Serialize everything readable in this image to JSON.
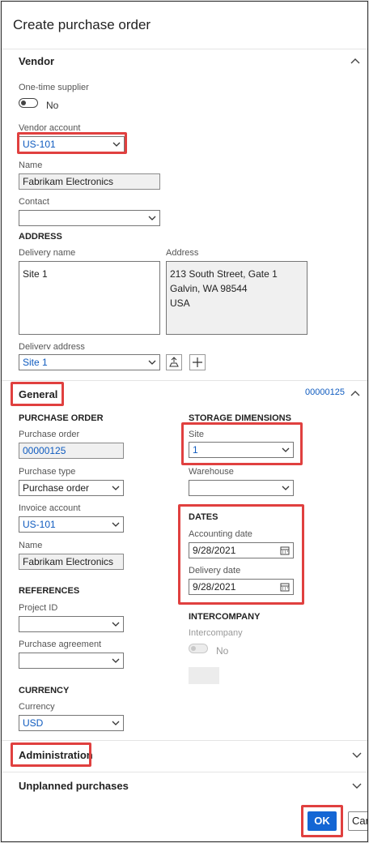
{
  "dialog": {
    "title": "Create purchase order"
  },
  "vendor": {
    "section_label": "Vendor",
    "one_time_supplier_label": "One-time supplier",
    "one_time_supplier_value": "No",
    "vendor_account_label": "Vendor account",
    "vendor_account_value": "US-101",
    "name_label": "Name",
    "name_value": "Fabrikam Electronics",
    "contact_label": "Contact",
    "contact_value": "",
    "address_heading": "ADDRESS",
    "delivery_name_label": "Delivery name",
    "delivery_name_value": "Site 1",
    "address_label": "Address",
    "address_lines": [
      "213 South Street, Gate 1",
      "Galvin, WA 98544",
      "USA"
    ],
    "delivery_address_label": "Delivery address",
    "delivery_address_value": "Site 1"
  },
  "general": {
    "section_label": "General",
    "summary_value": "00000125",
    "purchase_order_heading": "PURCHASE ORDER",
    "purchase_order_label": "Purchase order",
    "purchase_order_value": "00000125",
    "purchase_type_label": "Purchase type",
    "purchase_type_value": "Purchase order",
    "invoice_account_label": "Invoice account",
    "invoice_account_value": "US-101",
    "name_label": "Name",
    "name_value": "Fabrikam Electronics",
    "references_heading": "REFERENCES",
    "project_id_label": "Project ID",
    "project_id_value": "",
    "purchase_agreement_label": "Purchase agreement",
    "purchase_agreement_value": "",
    "currency_heading": "CURRENCY",
    "currency_label": "Currency",
    "currency_value": "USD",
    "storage_heading": "STORAGE DIMENSIONS",
    "site_label": "Site",
    "site_value": "1",
    "warehouse_label": "Warehouse",
    "warehouse_value": "",
    "dates_heading": "DATES",
    "accounting_date_label": "Accounting date",
    "accounting_date_value": "9/28/2021",
    "delivery_date_label": "Delivery date",
    "delivery_date_value": "9/28/2021",
    "intercompany_heading": "INTERCOMPANY",
    "intercompany_label": "Intercompany",
    "intercompany_value": "No"
  },
  "administration": {
    "section_label": "Administration"
  },
  "unplanned": {
    "section_label": "Unplanned purchases"
  },
  "footer": {
    "ok_label": "OK",
    "cancel_label": "Can"
  },
  "colors": {
    "accent": "#1466d4",
    "highlight": "#e0403f",
    "link": "#0f5bbf"
  }
}
